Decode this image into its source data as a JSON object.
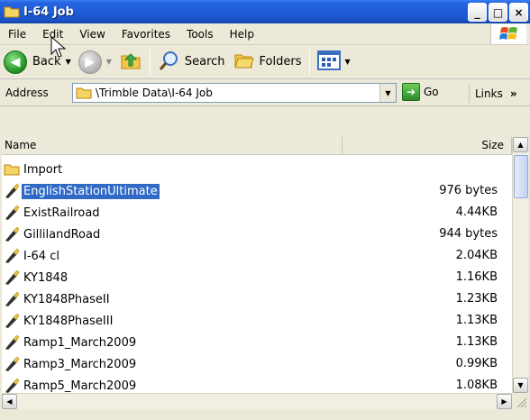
{
  "window": {
    "title": "I-64 Job"
  },
  "title_buttons": [
    "_",
    "□",
    "×"
  ],
  "menu": [
    "File",
    "Edit",
    "View",
    "Favorites",
    "Tools",
    "Help"
  ],
  "toolbar": {
    "back_label": "Back",
    "search_label": "Search",
    "folders_label": "Folders"
  },
  "address": {
    "label": "Address",
    "path": "\\Trimble Data\\I-64 Job",
    "go_label": "Go",
    "links_label": "Links"
  },
  "columns": {
    "name": "Name",
    "size": "Size"
  },
  "files": [
    {
      "name": "Import",
      "size": "",
      "type": "folder"
    },
    {
      "name": "EnglishStationUltimate",
      "size": "976 bytes",
      "type": "file",
      "selected": true
    },
    {
      "name": "ExistRailroad",
      "size": "4.44KB",
      "type": "file"
    },
    {
      "name": "GillilandRoad",
      "size": "944 bytes",
      "type": "file"
    },
    {
      "name": "I-64 cl",
      "size": "2.04KB",
      "type": "file"
    },
    {
      "name": "KY1848",
      "size": "1.16KB",
      "type": "file"
    },
    {
      "name": "KY1848PhaseII",
      "size": "1.23KB",
      "type": "file"
    },
    {
      "name": "KY1848PhaseIII",
      "size": "1.13KB",
      "type": "file"
    },
    {
      "name": "Ramp1_March2009",
      "size": "1.13KB",
      "type": "file"
    },
    {
      "name": "Ramp3_March2009",
      "size": "0.99KB",
      "type": "file"
    },
    {
      "name": "Ramp5_March2009",
      "size": "1.08KB",
      "type": "file"
    }
  ],
  "colors": {
    "title_bar": "#1F5DD8",
    "selection": "#316AC5",
    "chrome": "#ECE9D8"
  }
}
